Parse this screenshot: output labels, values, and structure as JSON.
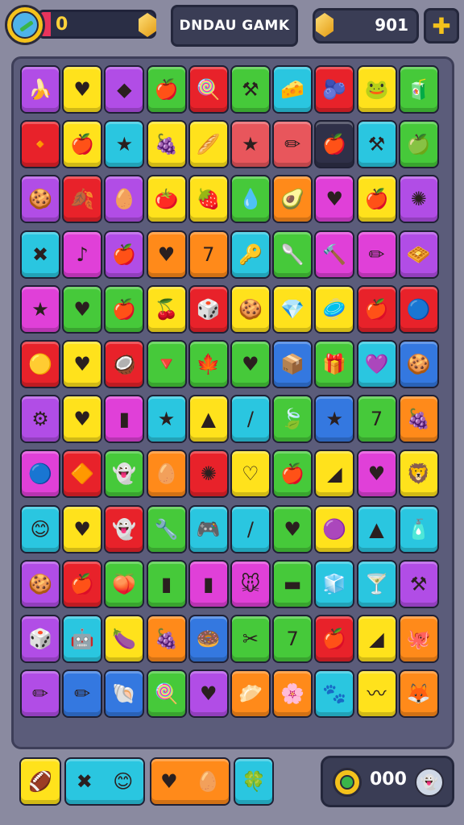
{
  "header": {
    "progress_value": "0",
    "progress_fill": 0.1,
    "title": "DNDAU GAMK",
    "score": "901",
    "plus_glyph": "✚"
  },
  "colors": {
    "Y": "#ffe21c",
    "R": "#e8222a",
    "G": "#46c93a",
    "C": "#2ac6e0",
    "P": "#b14de6",
    "O": "#ff8a1a",
    "M": "#e040d8",
    "B": "#3478e0",
    "S": "#e8565c",
    "N": "#2f3048"
  },
  "board": {
    "rows": [
      [
        {
          "c": "P",
          "i": "🍌",
          "n": "banana-icon"
        },
        {
          "c": "Y",
          "i": "♥",
          "n": "heart-icon"
        },
        {
          "c": "P",
          "i": "◆",
          "n": "cube-icon"
        },
        {
          "c": "G",
          "i": "🍎",
          "n": "apple-icon"
        },
        {
          "c": "R",
          "i": "🍭",
          "n": "lollipop-icon"
        },
        {
          "c": "G",
          "i": "⚒",
          "n": "hammer-icon"
        },
        {
          "c": "C",
          "i": "🧀",
          "n": "cheese-icon"
        },
        {
          "c": "R",
          "i": "🫐",
          "n": "berry-icon"
        },
        {
          "c": "Y",
          "i": "🐸",
          "n": "frog-icon"
        },
        {
          "c": "G",
          "i": "🧃",
          "n": "box-icon"
        }
      ],
      [
        {
          "c": "R",
          "i": "🔸",
          "n": "drop-icon"
        },
        {
          "c": "Y",
          "i": "🍎",
          "n": "apple-icon"
        },
        {
          "c": "C",
          "i": "★",
          "n": "star-icon"
        },
        {
          "c": "Y",
          "i": "🍇",
          "n": "grape-icon"
        },
        {
          "c": "Y",
          "i": "🥖",
          "n": "bread-icon"
        },
        {
          "c": "S",
          "i": "★",
          "n": "star-icon"
        },
        {
          "c": "S",
          "i": "✏",
          "n": "pencil-icon"
        },
        {
          "c": "N",
          "i": "🍎",
          "n": "apple-icon"
        },
        {
          "c": "C",
          "i": "⚒",
          "n": "hammer-icon"
        },
        {
          "c": "G",
          "i": "🍏",
          "n": "green-apple-icon"
        }
      ],
      [
        {
          "c": "P",
          "i": "🍪",
          "n": "cookie-icon"
        },
        {
          "c": "R",
          "i": "🍂",
          "n": "leaf-icon"
        },
        {
          "c": "P",
          "i": "🥚",
          "n": "egg-icon"
        },
        {
          "c": "Y",
          "i": "🍅",
          "n": "tomato-icon"
        },
        {
          "c": "Y",
          "i": "🍓",
          "n": "strawberry-icon"
        },
        {
          "c": "G",
          "i": "💧",
          "n": "drop-icon"
        },
        {
          "c": "O",
          "i": "🥑",
          "n": "seed-icon"
        },
        {
          "c": "M",
          "i": "♥",
          "n": "heart-icon"
        },
        {
          "c": "Y",
          "i": "🍎",
          "n": "apple-icon"
        },
        {
          "c": "P",
          "i": "✺",
          "n": "sun-icon"
        }
      ],
      [
        {
          "c": "C",
          "i": "✖",
          "n": "cross-icon"
        },
        {
          "c": "M",
          "i": "♪",
          "n": "note-icon"
        },
        {
          "c": "P",
          "i": "🍎",
          "n": "apple-icon"
        },
        {
          "c": "O",
          "i": "♥",
          "n": "heart-icon"
        },
        {
          "c": "O",
          "i": "7",
          "n": "seven-icon"
        },
        {
          "c": "C",
          "i": "🔑",
          "n": "key-icon"
        },
        {
          "c": "G",
          "i": "🥄",
          "n": "spoon-icon"
        },
        {
          "c": "M",
          "i": "🔨",
          "n": "mallet-icon"
        },
        {
          "c": "M",
          "i": "✏",
          "n": "pencil-icon"
        },
        {
          "c": "P",
          "i": "🧇",
          "n": "waffle-icon"
        }
      ],
      [
        {
          "c": "M",
          "i": "★",
          "n": "star-icon"
        },
        {
          "c": "G",
          "i": "♥",
          "n": "heart-icon"
        },
        {
          "c": "G",
          "i": "🍎",
          "n": "apple-icon"
        },
        {
          "c": "Y",
          "i": "🍒",
          "n": "cherry-icon"
        },
        {
          "c": "R",
          "i": "🎲",
          "n": "dice-icon"
        },
        {
          "c": "Y",
          "i": "🍪",
          "n": "cookie-icon"
        },
        {
          "c": "Y",
          "i": "💎",
          "n": "diamond-icon"
        },
        {
          "c": "Y",
          "i": "🥏",
          "n": "disc-icon"
        },
        {
          "c": "R",
          "i": "🍎",
          "n": "apple-icon"
        },
        {
          "c": "R",
          "i": "🔵",
          "n": "orb-icon"
        }
      ],
      [
        {
          "c": "R",
          "i": "🟡",
          "n": "coin-icon"
        },
        {
          "c": "Y",
          "i": "♥",
          "n": "heart-icon"
        },
        {
          "c": "R",
          "i": "🥥",
          "n": "coconut-icon"
        },
        {
          "c": "G",
          "i": "🔻",
          "n": "gem-icon"
        },
        {
          "c": "G",
          "i": "🍁",
          "n": "maple-icon"
        },
        {
          "c": "G",
          "i": "♥",
          "n": "heart-icon"
        },
        {
          "c": "B",
          "i": "📦",
          "n": "crate-icon"
        },
        {
          "c": "G",
          "i": "🎁",
          "n": "gift-icon"
        },
        {
          "c": "C",
          "i": "💜",
          "n": "balloon-icon"
        },
        {
          "c": "B",
          "i": "🍪",
          "n": "cookie-icon"
        }
      ],
      [
        {
          "c": "P",
          "i": "⚙",
          "n": "gear-icon"
        },
        {
          "c": "Y",
          "i": "♥",
          "n": "heart-icon"
        },
        {
          "c": "M",
          "i": "▮",
          "n": "stick-icon"
        },
        {
          "c": "C",
          "i": "★",
          "n": "star-icon"
        },
        {
          "c": "Y",
          "i": "▲",
          "n": "triangle-icon"
        },
        {
          "c": "C",
          "i": "/",
          "n": "stick-icon"
        },
        {
          "c": "G",
          "i": "🍃",
          "n": "leaf-icon"
        },
        {
          "c": "B",
          "i": "★",
          "n": "star-icon"
        },
        {
          "c": "G",
          "i": "7",
          "n": "seven-icon"
        },
        {
          "c": "O",
          "i": "🍇",
          "n": "grape-icon"
        }
      ],
      [
        {
          "c": "M",
          "i": "🔵",
          "n": "orb-icon"
        },
        {
          "c": "R",
          "i": "🔶",
          "n": "diamond-icon"
        },
        {
          "c": "G",
          "i": "👻",
          "n": "ghost-icon"
        },
        {
          "c": "O",
          "i": "🥚",
          "n": "egg-icon"
        },
        {
          "c": "R",
          "i": "✺",
          "n": "sun-icon"
        },
        {
          "c": "Y",
          "i": "♡",
          "n": "heart-outline-icon"
        },
        {
          "c": "G",
          "i": "🍎",
          "n": "apple-icon"
        },
        {
          "c": "Y",
          "i": "◢",
          "n": "triangle-icon"
        },
        {
          "c": "M",
          "i": "♥",
          "n": "heart-icon"
        },
        {
          "c": "Y",
          "i": "🦁",
          "n": "lion-icon"
        }
      ],
      [
        {
          "c": "C",
          "i": "😊",
          "n": "smile-icon"
        },
        {
          "c": "Y",
          "i": "♥",
          "n": "heart-icon"
        },
        {
          "c": "R",
          "i": "👻",
          "n": "ghost-icon"
        },
        {
          "c": "G",
          "i": "🔧",
          "n": "wrench-icon"
        },
        {
          "c": "C",
          "i": "🎮",
          "n": "gamepad-icon"
        },
        {
          "c": "C",
          "i": "/",
          "n": "stick-icon"
        },
        {
          "c": "G",
          "i": "♥",
          "n": "heart-icon"
        },
        {
          "c": "Y",
          "i": "🟣",
          "n": "blob-icon"
        },
        {
          "c": "C",
          "i": "▲",
          "n": "cone-icon"
        },
        {
          "c": "C",
          "i": "🧴",
          "n": "bottle-icon"
        }
      ],
      [
        {
          "c": "P",
          "i": "🍪",
          "n": "cookie-icon"
        },
        {
          "c": "R",
          "i": "🍎",
          "n": "apple-icon"
        },
        {
          "c": "G",
          "i": "🍑",
          "n": "peach-icon"
        },
        {
          "c": "G",
          "i": "▮",
          "n": "battery-icon"
        },
        {
          "c": "M",
          "i": "▮",
          "n": "bar-icon"
        },
        {
          "c": "M",
          "i": "🐭",
          "n": "mouse-icon"
        },
        {
          "c": "G",
          "i": "▬",
          "n": "bar-icon"
        },
        {
          "c": "C",
          "i": "🧊",
          "n": "cube-icon"
        },
        {
          "c": "C",
          "i": "🍸",
          "n": "glass-icon"
        },
        {
          "c": "P",
          "i": "⚒",
          "n": "hammer-icon"
        }
      ],
      [
        {
          "c": "P",
          "i": "🎲",
          "n": "dice-icon"
        },
        {
          "c": "C",
          "i": "🤖",
          "n": "robot-icon"
        },
        {
          "c": "Y",
          "i": "🍆",
          "n": "plum-icon"
        },
        {
          "c": "O",
          "i": "🍇",
          "n": "grape-icon"
        },
        {
          "c": "B",
          "i": "🍩",
          "n": "donut-icon"
        },
        {
          "c": "G",
          "i": "✂",
          "n": "scissors-icon"
        },
        {
          "c": "G",
          "i": "7",
          "n": "seven-icon"
        },
        {
          "c": "R",
          "i": "🍎",
          "n": "apple-icon"
        },
        {
          "c": "Y",
          "i": "◢",
          "n": "triangle-icon"
        },
        {
          "c": "O",
          "i": "🐙",
          "n": "octopus-icon"
        }
      ],
      [
        {
          "c": "P",
          "i": "✏",
          "n": "pencil-icon"
        },
        {
          "c": "B",
          "i": "✏",
          "n": "pencil-icon"
        },
        {
          "c": "B",
          "i": "🐚",
          "n": "shell-icon"
        },
        {
          "c": "G",
          "i": "🍭",
          "n": "lollipop-icon"
        },
        {
          "c": "P",
          "i": "♥",
          "n": "heart-icon"
        },
        {
          "c": "O",
          "i": "🥟",
          "n": "dumpling-icon"
        },
        {
          "c": "O",
          "i": "🌸",
          "n": "flower-icon"
        },
        {
          "c": "C",
          "i": "🐾",
          "n": "paw-icon"
        },
        {
          "c": "Y",
          "i": "〰",
          "n": "squiggle-icon"
        },
        {
          "c": "O",
          "i": "🦊",
          "n": "fox-icon"
        }
      ]
    ]
  },
  "tray": [
    {
      "c": "Y",
      "icons": [
        {
          "i": "🏈",
          "n": "ball-icon"
        }
      ]
    },
    {
      "c": "C",
      "icons": [
        {
          "i": "✖",
          "n": "cross-icon"
        },
        {
          "i": "😊",
          "n": "smile-icon"
        }
      ]
    },
    {
      "c": "O",
      "icons": [
        {
          "i": "♥",
          "n": "heart-icon"
        },
        {
          "i": "🥚",
          "n": "egg-icon"
        }
      ]
    },
    {
      "c": "C",
      "icons": [
        {
          "i": "🍀",
          "n": "clover-icon"
        }
      ]
    }
  ],
  "coins": {
    "value": "000",
    "ghost_glyph": "👻"
  }
}
